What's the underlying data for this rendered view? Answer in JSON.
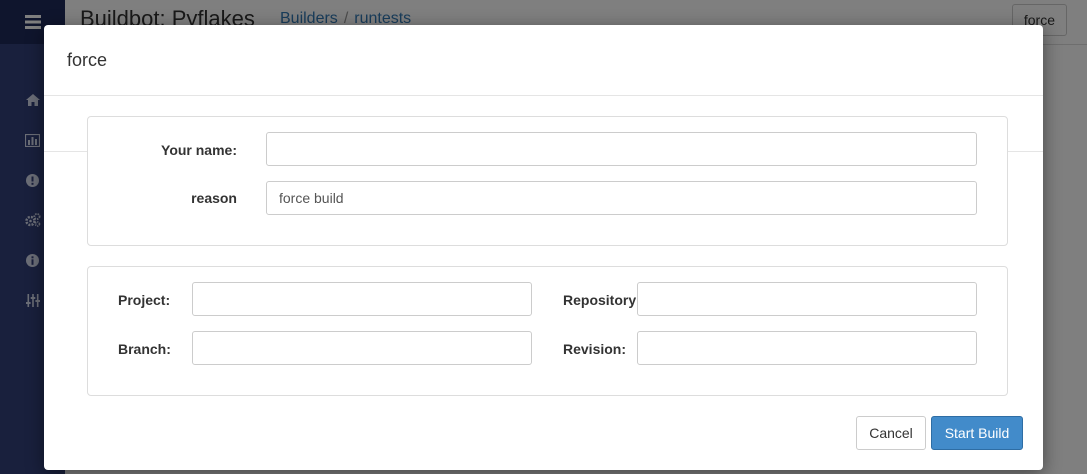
{
  "app": {
    "title": "Buildbot: Pyflakes",
    "breadcrumbs": [
      "Builders",
      "runtests"
    ],
    "breadcrumb_separator": "/",
    "top_button_label": "force"
  },
  "sidebar": {
    "icons": [
      "menu-icon",
      "home-icon",
      "bar-chart-icon",
      "exclamation-icon",
      "gears-icon",
      "info-icon",
      "sliders-icon"
    ]
  },
  "modal": {
    "title": "force",
    "panel1": {
      "name_label": "Your name:",
      "name_value": "",
      "reason_label": "reason",
      "reason_value": "force build"
    },
    "panel2": {
      "project_label": "Project:",
      "project_value": "",
      "repository_label": "Repository:",
      "repository_value": "",
      "branch_label": "Branch:",
      "branch_value": "",
      "revision_label": "Revision:",
      "revision_value": ""
    },
    "cancel_label": "Cancel",
    "submit_label": "Start Build"
  },
  "colors": {
    "sidebar": "#32407a",
    "sidebar_top": "#1e2a5a",
    "primary": "#428bca",
    "link": "#337ab7"
  }
}
